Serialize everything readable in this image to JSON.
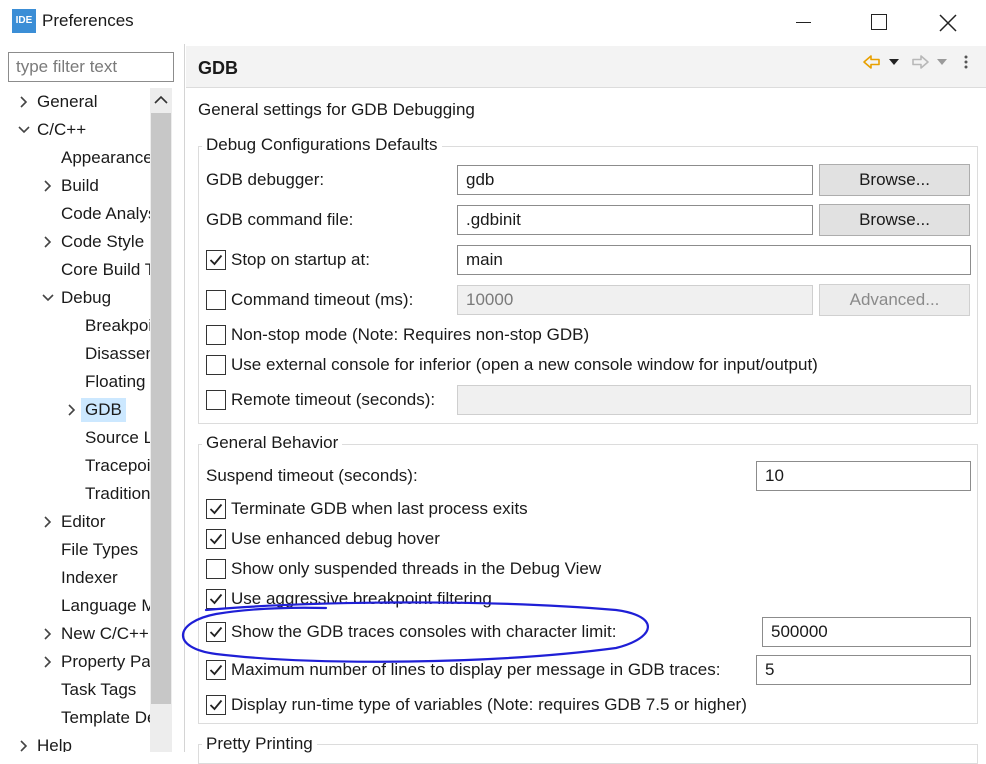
{
  "window": {
    "app_icon_text": "IDE",
    "title": "Preferences"
  },
  "filter": {
    "placeholder": "type filter text"
  },
  "tree": [
    {
      "label": "General",
      "level": 0,
      "expander": "collapsed"
    },
    {
      "label": "C/C++",
      "level": 0,
      "expander": "expanded"
    },
    {
      "label": "Appearance",
      "level": 1,
      "expander": "none"
    },
    {
      "label": "Build",
      "level": 1,
      "expander": "collapsed"
    },
    {
      "label": "Code Analysis",
      "level": 1,
      "expander": "none"
    },
    {
      "label": "Code Style",
      "level": 1,
      "expander": "collapsed"
    },
    {
      "label": "Core Build Toolchains",
      "level": 1,
      "expander": "none"
    },
    {
      "label": "Debug",
      "level": 1,
      "expander": "expanded"
    },
    {
      "label": "Breakpoint Actions",
      "level": 2,
      "expander": "none"
    },
    {
      "label": "Disassembly",
      "level": 2,
      "expander": "none"
    },
    {
      "label": "Floating Point",
      "level": 2,
      "expander": "none"
    },
    {
      "label": "GDB",
      "level": 2,
      "expander": "collapsed",
      "selected": true
    },
    {
      "label": "Source Lookup Path",
      "level": 2,
      "expander": "none"
    },
    {
      "label": "Tracepoint Actions",
      "level": 2,
      "expander": "none"
    },
    {
      "label": "Traditional Memory Rendering",
      "level": 2,
      "expander": "none"
    },
    {
      "label": "Editor",
      "level": 1,
      "expander": "collapsed"
    },
    {
      "label": "File Types",
      "level": 1,
      "expander": "none"
    },
    {
      "label": "Indexer",
      "level": 1,
      "expander": "none"
    },
    {
      "label": "Language Mappings",
      "level": 1,
      "expander": "none"
    },
    {
      "label": "New C/C++ Project Wizard",
      "level": 1,
      "expander": "collapsed"
    },
    {
      "label": "Property Pages Settings",
      "level": 1,
      "expander": "collapsed"
    },
    {
      "label": "Task Tags",
      "level": 1,
      "expander": "none"
    },
    {
      "label": "Template Default Values",
      "level": 1,
      "expander": "none"
    },
    {
      "label": "Help",
      "level": 0,
      "expander": "collapsed"
    }
  ],
  "page": {
    "title": "GDB",
    "description": "General settings for GDB Debugging",
    "defaults": {
      "title": "Debug Configurations Defaults",
      "debugger_label": "GDB debugger:",
      "debugger_value": "gdb",
      "command_file_label": "GDB command file:",
      "command_file_value": ".gdbinit",
      "browse_label": "Browse...",
      "stop_on_startup_label": "Stop on startup at:",
      "stop_on_startup_checked": true,
      "stop_on_startup_value": "main",
      "command_timeout_label": "Command timeout (ms):",
      "command_timeout_checked": false,
      "command_timeout_value": "10000",
      "advanced_label": "Advanced...",
      "non_stop_label": "Non-stop mode (Note: Requires non-stop GDB)",
      "non_stop_checked": false,
      "external_console_label": "Use external console for inferior (open a new console window for input/output)",
      "external_console_checked": false,
      "remote_timeout_label": "Remote timeout (seconds):",
      "remote_timeout_checked": false,
      "remote_timeout_value": ""
    },
    "behavior": {
      "title": "General Behavior",
      "suspend_timeout_label": "Suspend timeout (seconds):",
      "suspend_timeout_value": "10",
      "terminate_label": "Terminate GDB when last process exits",
      "terminate_checked": true,
      "hover_label": "Use enhanced debug hover",
      "hover_checked": true,
      "suspended_threads_label": "Show only suspended threads in the Debug View",
      "suspended_threads_checked": false,
      "aggressive_label": "Use aggressive breakpoint filtering",
      "aggressive_checked": true,
      "traces_label": "Show the GDB traces consoles with character limit:",
      "traces_checked": true,
      "traces_value": "500000",
      "max_lines_label": "Maximum number of lines to display per message in GDB traces:",
      "max_lines_checked": true,
      "max_lines_value": "5",
      "rtti_label": "Display run-time type of variables (Note: requires GDB 7.5 or higher)",
      "rtti_checked": true
    },
    "pretty_printing": {
      "title": "Pretty Printing"
    }
  },
  "colors": {
    "selection": "#cce8ff",
    "annotation": "#1f1fd6",
    "nav_arrow": "#e8a000"
  }
}
